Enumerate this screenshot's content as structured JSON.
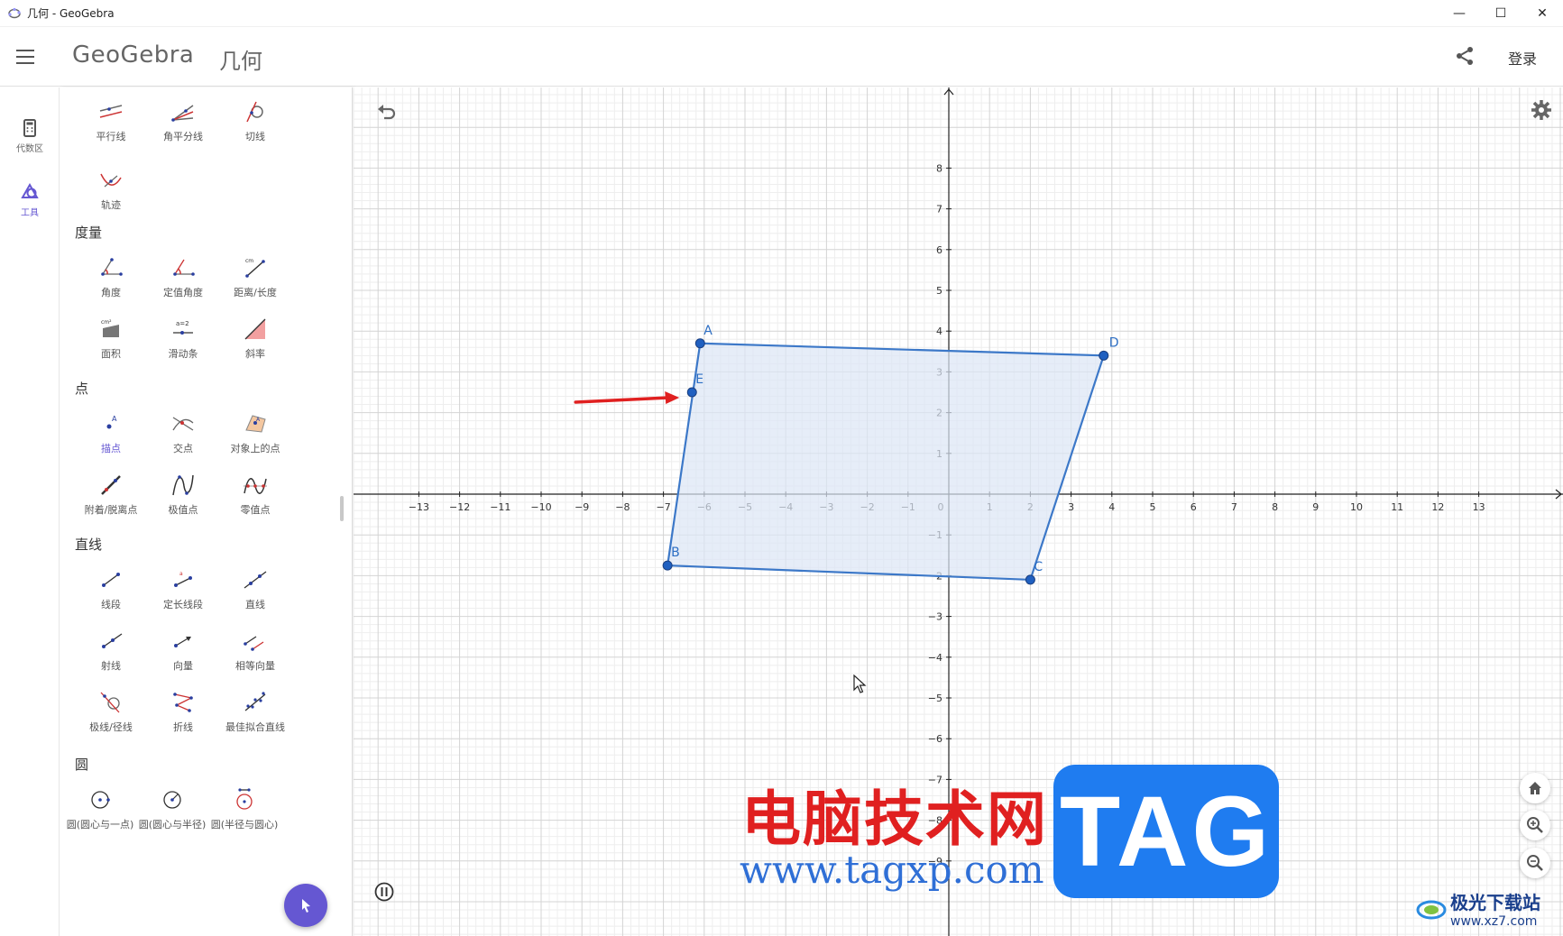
{
  "window": {
    "title": "几何 - GeoGebra",
    "controls": {
      "minimize": "—",
      "maximize": "☐",
      "close": "✕"
    }
  },
  "header": {
    "logo": "GeoGebra",
    "app_name": "几何",
    "login": "登录",
    "share_icon": "share-icon"
  },
  "rail": {
    "items": [
      {
        "label": "代数区",
        "icon": "calculator-icon"
      },
      {
        "label": "工具",
        "icon": "shapes-icon",
        "active": true
      }
    ]
  },
  "tools": {
    "top": [
      {
        "label": "平行线",
        "icon": "parallel-line-icon"
      },
      {
        "label": "角平分线",
        "icon": "angle-bisector-icon"
      },
      {
        "label": "切线",
        "icon": "tangent-icon"
      },
      {
        "label": "轨迹",
        "icon": "locus-icon"
      }
    ],
    "sections": [
      {
        "title": "度量",
        "items": [
          {
            "label": "角度",
            "icon": "angle-icon"
          },
          {
            "label": "定值角度",
            "icon": "fixed-angle-icon"
          },
          {
            "label": "距离/长度",
            "icon": "distance-icon"
          },
          {
            "label": "面积",
            "icon": "area-icon"
          },
          {
            "label": "滑动条",
            "icon": "slider-icon"
          },
          {
            "label": "斜率",
            "icon": "slope-icon"
          }
        ]
      },
      {
        "title": "点",
        "items": [
          {
            "label": "描点",
            "icon": "point-icon",
            "selected": true
          },
          {
            "label": "交点",
            "icon": "intersect-icon"
          },
          {
            "label": "对象上的点",
            "icon": "point-on-object-icon"
          },
          {
            "label": "附着/脱离点",
            "icon": "attach-detach-icon"
          },
          {
            "label": "极值点",
            "icon": "extremum-icon"
          },
          {
            "label": "零值点",
            "icon": "roots-icon"
          }
        ]
      },
      {
        "title": "直线",
        "items": [
          {
            "label": "线段",
            "icon": "segment-icon"
          },
          {
            "label": "定长线段",
            "icon": "fixed-segment-icon"
          },
          {
            "label": "直线",
            "icon": "line-icon"
          },
          {
            "label": "射线",
            "icon": "ray-icon"
          },
          {
            "label": "向量",
            "icon": "vector-icon"
          },
          {
            "label": "相等向量",
            "icon": "vector-from-point-icon"
          },
          {
            "label": "极线/径线",
            "icon": "polar-line-icon"
          },
          {
            "label": "折线",
            "icon": "polyline-icon"
          },
          {
            "label": "最佳拟合直线",
            "icon": "best-fit-line-icon"
          }
        ]
      },
      {
        "title": "圆",
        "items": [
          {
            "label": "圆(圆心与一点)",
            "icon": "circle-center-point-icon"
          },
          {
            "label": "圆(圆心与半径)",
            "icon": "circle-center-radius-icon"
          },
          {
            "label": "圆(半径与圆心)",
            "icon": "compass-icon"
          }
        ]
      }
    ]
  },
  "graphics": {
    "x_range": [
      -13,
      13
    ],
    "y_range": [
      -9,
      8
    ],
    "x_ticks": [
      "-13",
      "-12",
      "-11",
      "-10",
      "-9",
      "-8",
      "-7",
      "-6",
      "-5",
      "-4",
      "-3",
      "-2",
      "-1",
      "0",
      "1",
      "2",
      "3",
      "4",
      "5",
      "6",
      "7",
      "8",
      "9",
      "10",
      "11",
      "12",
      "13"
    ],
    "y_ticks": [
      "8",
      "7",
      "6",
      "5",
      "4",
      "3",
      "2",
      "1",
      "0",
      "-1",
      "-2",
      "-3",
      "-4",
      "-5",
      "-6",
      "-7",
      "-8",
      "-9"
    ],
    "polygon": {
      "fill": "#dce6f5",
      "stroke": "#3c78c8",
      "points": [
        {
          "name": "A",
          "x": -6.1,
          "y": 3.7
        },
        {
          "name": "D",
          "x": 3.8,
          "y": 3.4
        },
        {
          "name": "C",
          "x": 2.0,
          "y": -2.1
        },
        {
          "name": "B",
          "x": -6.9,
          "y": -1.75
        }
      ]
    },
    "point_E": {
      "name": "E",
      "x": -6.3,
      "y": 2.5
    },
    "arrow_color": "#e02020",
    "icons": [
      "undo-icon",
      "settings-icon",
      "pause-icon",
      "home-icon",
      "zoom-in-icon",
      "zoom-out-icon"
    ]
  },
  "watermark": {
    "cn": "电脑技术网",
    "url": "www.tagxp.com",
    "tag": "TAG",
    "corner_cn": "极光下载站",
    "corner_url": "www.xz7.com"
  }
}
